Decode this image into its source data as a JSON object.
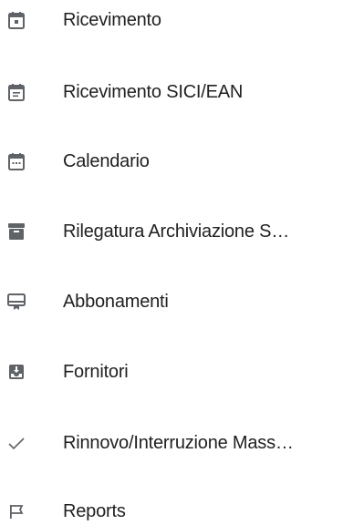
{
  "menu": {
    "items": [
      {
        "label": "Ricevimento",
        "icon": "event-icon"
      },
      {
        "label": "Ricevimento SICI/EAN",
        "icon": "notes-icon"
      },
      {
        "label": "Calendario",
        "icon": "calendar-dots-icon"
      },
      {
        "label": "Rilegatura Archiviazione S…",
        "icon": "archive-icon"
      },
      {
        "label": "Abbonamenti",
        "icon": "card-membership-icon"
      },
      {
        "label": "Fornitori",
        "icon": "move-to-inbox-icon"
      },
      {
        "label": "Rinnovo/Interruzione Mass…",
        "icon": "check-icon"
      },
      {
        "label": "Reports",
        "icon": "flag-outline-icon"
      }
    ]
  },
  "colors": {
    "icon": "#5f6368",
    "text": "#212121",
    "background": "#ffffff"
  }
}
